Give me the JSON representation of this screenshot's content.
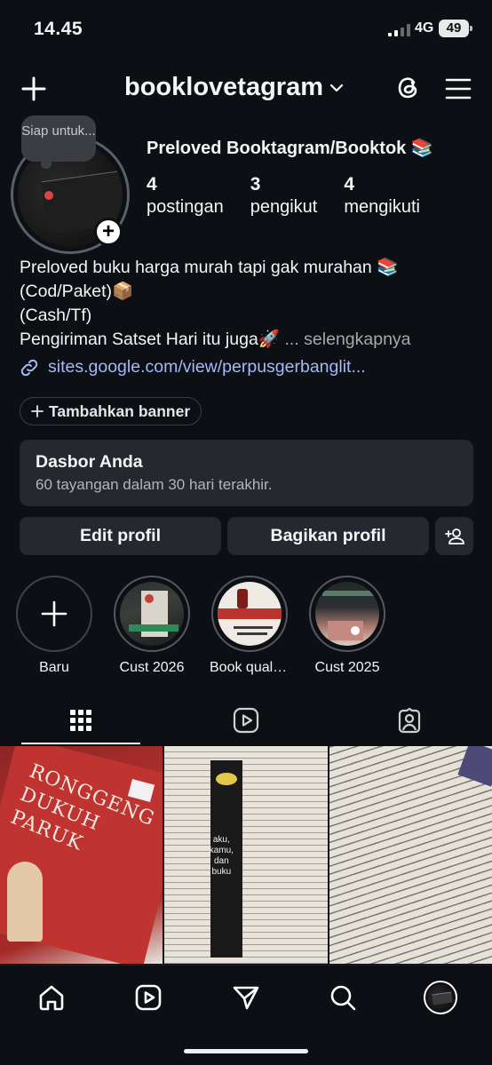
{
  "status_bar": {
    "time": "14.45",
    "network": "4G",
    "battery": "49"
  },
  "header": {
    "username": "booklovetagram"
  },
  "profile": {
    "note": "Siap untuk...",
    "display_name": "Preloved Booktagram/Booktok 📚",
    "stats": [
      {
        "value": "4",
        "label": "postingan"
      },
      {
        "value": "3",
        "label": "pengikut"
      },
      {
        "value": "4",
        "label": "mengikuti"
      }
    ],
    "bio_lines": [
      "Preloved buku harga murah tapi gak murahan 📚",
      "(Cod/Paket)📦",
      "(Cash/Tf)",
      "Pengiriman Satset Hari itu juga🚀"
    ],
    "bio_more": "... selengkapnya",
    "link": "sites.google.com/view/perpusgerbanglit...",
    "banner_chip": "Tambahkan banner"
  },
  "dashboard": {
    "title": "Dasbor Anda",
    "subtitle": "60 tayangan dalam 30 hari terakhir."
  },
  "buttons": {
    "edit": "Edit profil",
    "share": "Bagikan profil"
  },
  "highlights": [
    {
      "label": "Baru"
    },
    {
      "label": "Cust 2026"
    },
    {
      "label": "Book qualit..."
    },
    {
      "label": "Cust 2025"
    }
  ],
  "posts": [
    {
      "cover_text": "RONGGENG DUKUH PARUK"
    },
    {
      "cover_text": "aku, kamu, dan buku"
    },
    {
      "cover_text": ""
    }
  ],
  "colors": {
    "background": "#0c0f14",
    "surface": "#25282e",
    "link": "#a6b8f6"
  }
}
